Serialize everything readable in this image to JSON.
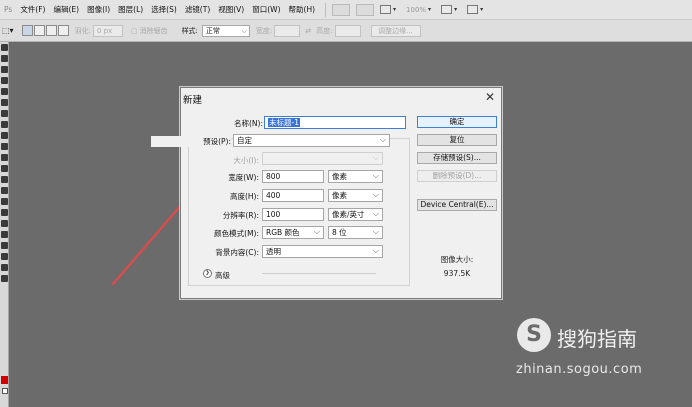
{
  "menubar": {
    "items": [
      "文件(F)",
      "编辑(E)",
      "图像(I)",
      "图层(L)",
      "选择(S)",
      "滤镜(T)",
      "视图(V)",
      "窗口(W)",
      "帮助(H)"
    ],
    "zoom": "100%"
  },
  "options": {
    "feather_label": "羽化:",
    "feather_value": "0 px",
    "antialias_label": "消除锯齿",
    "style_label": "样式:",
    "style_value": "正常",
    "width_label": "宽度:",
    "height_label": "高度:",
    "refine_label": "调整边缘..."
  },
  "dialog": {
    "title": "新建",
    "name_label": "名称(N):",
    "name_value": "未标题-1",
    "preset_label": "预设(P):",
    "preset_value": "自定",
    "size_label": "大小(I):",
    "width_label": "宽度(W):",
    "width_value": "800",
    "width_unit": "像素",
    "height_label": "高度(H):",
    "height_value": "400",
    "height_unit": "像素",
    "resolution_label": "分辨率(R):",
    "resolution_value": "100",
    "resolution_unit": "像素/英寸",
    "colormode_label": "颜色模式(M):",
    "colormode_value": "RGB 颜色",
    "colormode_depth": "8 位",
    "bg_label": "背景内容(C):",
    "bg_value": "透明",
    "advanced_label": "高级",
    "buttons": {
      "ok": "确定",
      "reset": "复位",
      "save_preset": "存储预设(S)...",
      "delete_preset": "删除预设(D)...",
      "device_central": "Device Central(E)..."
    },
    "image_size_label": "图像大小:",
    "image_size_value": "937.5K"
  },
  "watermark": {
    "name": "搜狗指南",
    "url": "zhinan.sogou.com"
  },
  "colors": {
    "canvas": "#6b6b6b",
    "arrow": "#e24a4a",
    "foreground_swatch": "#d20000"
  }
}
